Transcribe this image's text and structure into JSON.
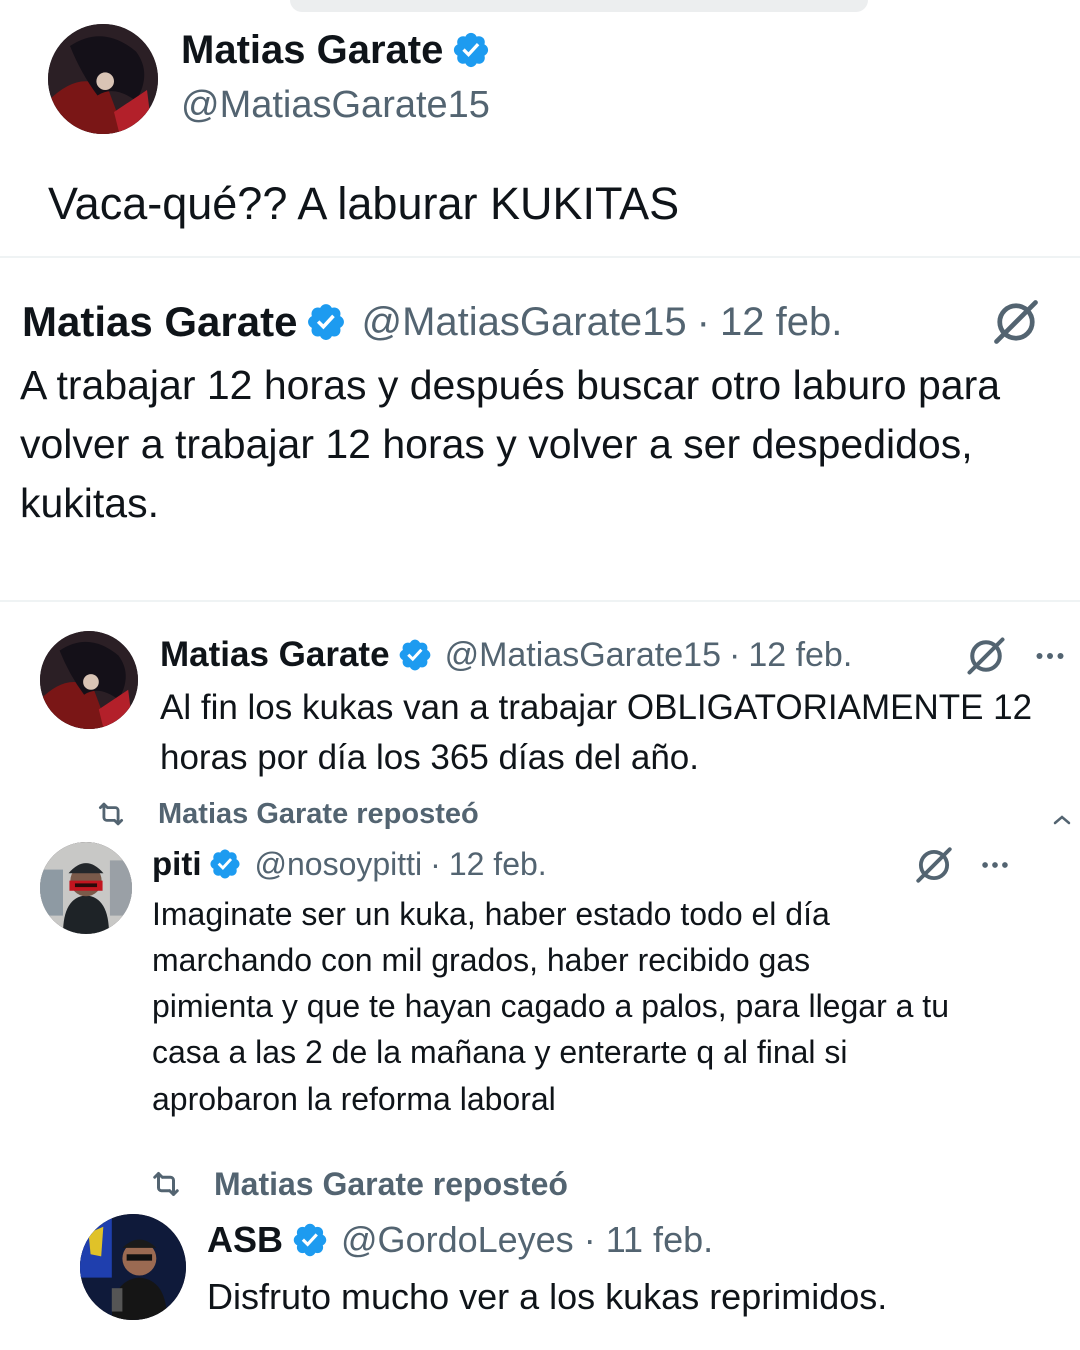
{
  "main_post": {
    "author": {
      "name": "Matias Garate",
      "handle": "@MatiasGarate15"
    },
    "text": "Vaca-qué?? A laburar KUKITAS"
  },
  "quoted_post": {
    "author": {
      "name": "Matias Garate",
      "handle": "@MatiasGarate15",
      "date": "12 feb."
    },
    "lines": [
      "A trabajar 12 horas y después buscar otro laburo para",
      "volver a trabajar 12 horas y volver a ser despedidos,",
      "kukitas."
    ]
  },
  "feed": [
    {
      "author": {
        "name": "Matias Garate",
        "handle": "@MatiasGarate15",
        "date": "12 feb."
      },
      "lines": [
        "Al fin los kukas van a trabajar OBLIGATORIAMENTE 12",
        "horas por día los 365 días del año."
      ]
    },
    {
      "repost_label": "Matias Garate reposteó",
      "author": {
        "name": "piti",
        "handle": "@nosoypitti",
        "date": "12 feb."
      },
      "lines": [
        "Imaginate ser un kuka, haber estado todo el día",
        "marchando con mil grados, haber recibido gas",
        "pimienta y que te hayan cagado a palos, para llegar a tu",
        "casa a las 2 de la mañana y enterarte q al final si",
        "aprobaron la reforma laboral"
      ]
    },
    {
      "repost_label": "Matias Garate reposteó",
      "author": {
        "name": "ASB",
        "handle": "@GordoLeyes",
        "date": "11 feb."
      },
      "lines": [
        "Disfruto mucho ver a los kukas reprimidos."
      ]
    }
  ],
  "separator": "·",
  "colors": {
    "verified": "#1d9bf0",
    "text": "#0f1419",
    "muted": "#536471"
  },
  "icons": [
    "verified-badge-icon",
    "grok-icon",
    "more-icon",
    "repost-icon",
    "chevron-up-icon"
  ]
}
